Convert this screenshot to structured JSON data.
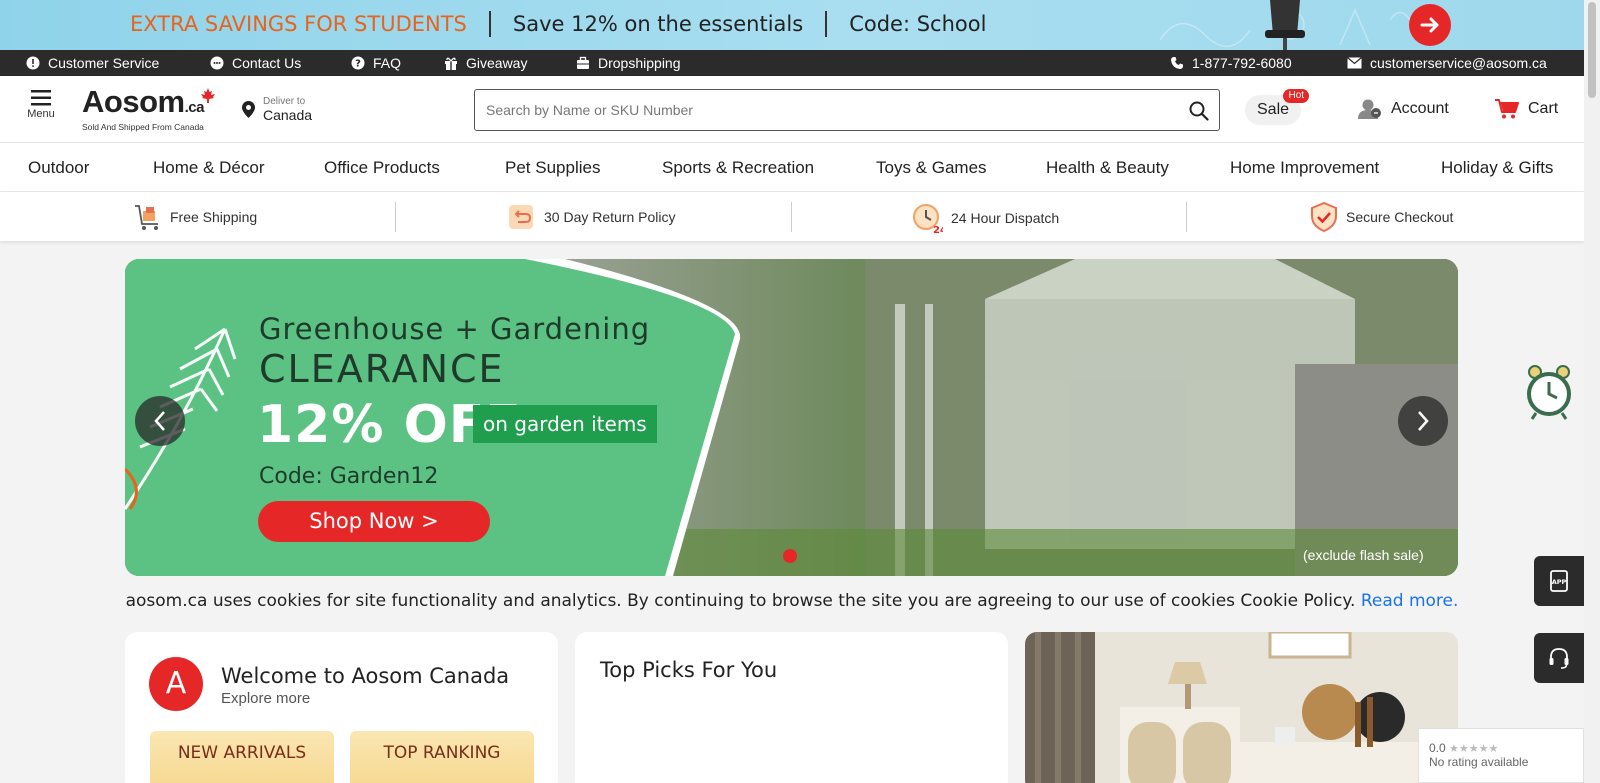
{
  "promo": {
    "part1": "EXTRA SAVINGS FOR STUDENTS",
    "part2": "Save 12% on the essentials",
    "part3": "Code: School"
  },
  "topbar": {
    "customer_service": "Customer Service",
    "contact_us": "Contact Us",
    "faq": "FAQ",
    "giveaway": "Giveaway",
    "dropshipping": "Dropshipping",
    "phone": "1-877-792-6080",
    "email": "customerservice@aosom.ca"
  },
  "header": {
    "menu_label": "Menu",
    "logo_word": "Aosom",
    "logo_suffix": ".ca",
    "logo_tagline": "Sold And Shipped From Canada",
    "deliver_to_label": "Deliver to",
    "deliver_to_value": "Canada",
    "search_placeholder": "Search by Name or SKU Number",
    "sale_label": "Sale",
    "sale_badge": "Hot",
    "account_label": "Account",
    "cart_label": "Cart"
  },
  "categories": [
    "Outdoor",
    "Home & Décor",
    "Office Products",
    "Pet Supplies",
    "Sports & Recreation",
    "Toys & Games",
    "Health & Beauty",
    "Home Improvement",
    "Holiday & Gifts"
  ],
  "benefits": [
    "Free Shipping",
    "30 Day Return Policy",
    "24 Hour Dispatch",
    "Secure Checkout"
  ],
  "hero": {
    "line1": "Greenhouse + Gardening",
    "line2": "CLEARANCE",
    "line3": "12% OFF",
    "tag": "on garden items",
    "code": "Code: Garden12",
    "button": "Shop Now >",
    "note": "(exclude flash sale)"
  },
  "cookie": {
    "text": "aosom.ca uses cookies for site functionality and analytics. By continuing to browse the site you are agreeing to our use of cookies Cookie Policy.",
    "link": "Read more."
  },
  "welcome": {
    "avatar": "A",
    "title": "Welcome to Aosom Canada",
    "subtitle": "Explore more",
    "tile1": "NEW ARRIVALS",
    "tile2": "TOP RANKING"
  },
  "picks": {
    "title": "Top Picks For You"
  },
  "rating": {
    "score": "0.0",
    "stars": "★★★★★",
    "text": "No rating available"
  },
  "colors": {
    "brand_red": "#e52727",
    "promo_orange": "#e8631c",
    "hero_green": "#5bc283",
    "link_blue": "#1a73e8"
  }
}
